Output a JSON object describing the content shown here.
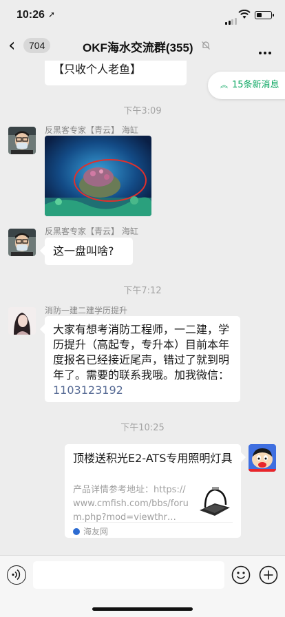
{
  "status": {
    "time": "10:26",
    "location_icon": "location-arrow-icon"
  },
  "nav": {
    "back_badge": "704",
    "title": "OKF海水交流群(355)",
    "mute_icon": "bell-muted-icon",
    "more_icon": "ellipsis-icon"
  },
  "new_messages": {
    "label": "15条新消息",
    "icon": "double-chevron-up-icon"
  },
  "messages": [
    {
      "type": "text",
      "text": "【只收个人老鱼】"
    },
    {
      "type": "timestamp",
      "text": "下午3:09"
    },
    {
      "type": "image",
      "sender": "反黑客专家【青云】 海缸",
      "content": "photo"
    },
    {
      "type": "text",
      "sender": "反黑客专家【青云】 海缸",
      "text": "这一盘叫啥?"
    },
    {
      "type": "timestamp",
      "text": "下午7:12"
    },
    {
      "type": "text",
      "sender": "消防一建二建学历提升",
      "text": "大家有想考消防工程师，一二建，学历提升（高起专，专升本）目前本年度报名已经接近尾声，错过了就到明年了。需要的联系我哦。加我微信：",
      "link": "1103123192"
    },
    {
      "type": "timestamp",
      "text": "下午10:25"
    },
    {
      "type": "link_card",
      "title": "顶楼送积光E2-ATS专用照明灯具",
      "description": "产品详情参考地址：https://www.cmfish.com/bbs/forum.php?mod=viewthr…",
      "source": "海友网"
    }
  ],
  "input": {
    "placeholder": "",
    "voice_icon": "voice-icon",
    "emoji_icon": "emoji-smile-icon",
    "plus_icon": "plus-circle-icon"
  },
  "colors": {
    "background": "#ededed",
    "link": "#576b95",
    "new_msg_green": "#07a55f"
  }
}
